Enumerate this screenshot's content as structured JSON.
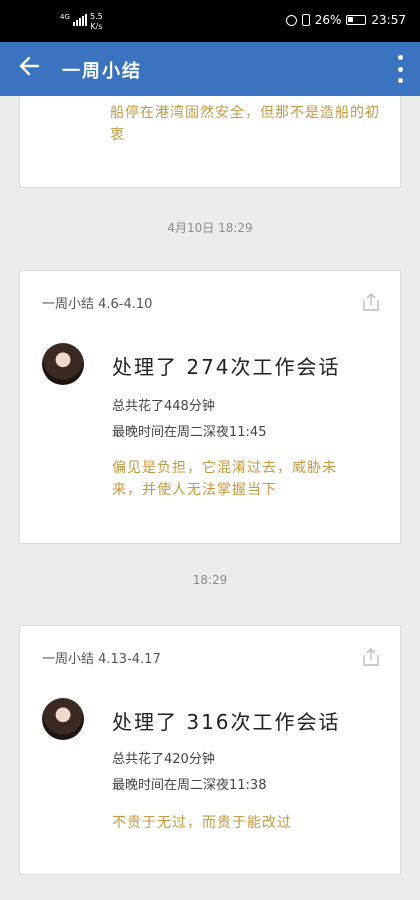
{
  "status_bar": {
    "network": "4G",
    "speed": "5.5\nK/s",
    "battery": "26%",
    "time": "23:57"
  },
  "app_bar": {
    "title": "一周小结"
  },
  "top_card": {
    "quote": "船停在港湾固然安全，但那不是造船的初衷"
  },
  "separators": [
    "4月10日  18:29",
    "18:29"
  ],
  "cards": [
    {
      "header": "一周小结 4.6-4.10",
      "headline": "处理了 274次工作会话",
      "total": "总共花了448分钟",
      "latest": "最晚时间在周二深夜11:45",
      "quote": "偏见是负担，它混淆过去，威胁未来，并使人无法掌握当下"
    },
    {
      "header": "一周小结 4.13-4.17",
      "headline": "处理了 316次工作会话",
      "total": "总共花了420分钟",
      "latest": "最晚时间在周二深夜11:38",
      "quote": "不贵于无过，而贵于能改过"
    }
  ],
  "colors": {
    "appbar": "#3a73c0",
    "quote": "#c8993f",
    "background": "#ececec"
  },
  "icons": [
    "back-arrow-icon",
    "more-vert-icon",
    "share-icon",
    "alarm-icon",
    "vibrate-icon",
    "battery-icon"
  ]
}
